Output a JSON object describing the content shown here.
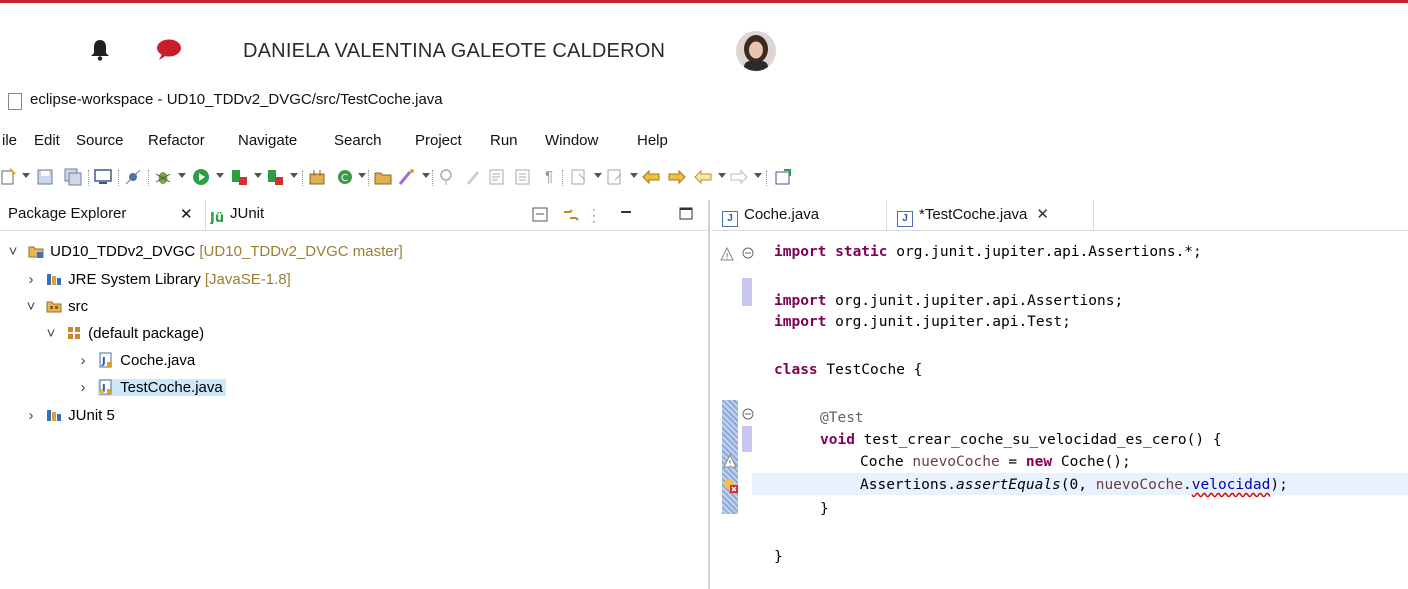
{
  "user": {
    "name": "DANIELA VALENTINA GALEOTE CALDERON"
  },
  "window": {
    "title": "eclipse-workspace - UD10_TDDv2_DVGC/src/TestCoche.java"
  },
  "menu": [
    "ile",
    "Edit",
    "Source",
    "Refactor",
    "Navigate",
    "Search",
    "Project",
    "Run",
    "Window",
    "Help"
  ],
  "left_panel": {
    "tabs": [
      {
        "label": "Package Explorer",
        "close": "✕"
      },
      {
        "label": "JUnit"
      }
    ],
    "tree": {
      "project": {
        "label": "UD10_TDDv2_DVGC",
        "decoration": "[UD10_TDDv2_DVGC master]"
      },
      "jre": {
        "label": "JRE System Library",
        "decoration": "[JavaSE-1.8]"
      },
      "src": {
        "label": "src"
      },
      "pkg": {
        "label": "(default package)"
      },
      "file1": {
        "label": "Coche.java"
      },
      "file2": {
        "label": "TestCoche.java"
      },
      "junit": {
        "label": "JUnit 5"
      }
    }
  },
  "editor": {
    "tabs": [
      {
        "label": "Coche.java"
      },
      {
        "label": "*TestCoche.java",
        "close": "✕"
      }
    ],
    "code": {
      "l1_kw": "import static",
      "l1_rest": " org.junit.jupiter.api.Assertions.*;",
      "l3_kw": "import",
      "l3_rest": " org.junit.jupiter.api.Assertions;",
      "l4_kw": "import",
      "l4_rest": " org.junit.jupiter.api.Test;",
      "l6_kw": "class",
      "l6_rest": " TestCoche {",
      "l8_ann": "@Test",
      "l9_kw": "void",
      "l9_rest": " test_crear_coche_su_velocidad_es_cero() {",
      "l10_type": "Coche ",
      "l10_var": "nuevoCoche",
      "l10_eq": " = ",
      "l10_kw": "new",
      "l10_rest": " Coche();",
      "l11_a": "Assertions.",
      "l11_m": "assertEquals",
      "l11_b": "(0, ",
      "l11_var": "nuevoCoche",
      "l11_dot": ".",
      "l11_field": "velocidad",
      "l11_end": ");",
      "l12": "}",
      "l14": "}"
    }
  },
  "colors": {
    "accent_line": "#c6212f",
    "selection": "#cde8fa",
    "keyword": "#7f0055",
    "field": "#0000c0"
  }
}
